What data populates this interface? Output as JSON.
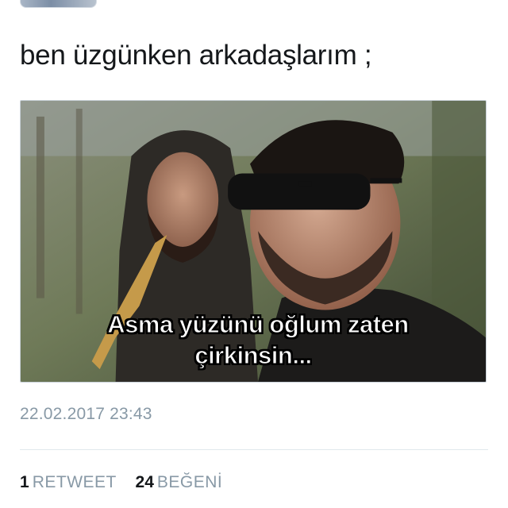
{
  "tweet": {
    "text": "ben üzgünken arkadaşlarım ;",
    "media": {
      "caption_line1": "Asma yüzünü oğlum zaten",
      "caption_line2": "çirkinsin..."
    },
    "timestamp": "22.02.2017 23:43"
  },
  "stats": {
    "retweets_count": "1",
    "retweets_label": "RETWEET",
    "likes_count": "24",
    "likes_label": "BEĞENİ"
  },
  "colors": {
    "text_primary": "#14171a",
    "text_secondary": "#8899a6",
    "divider": "#e1e8ed"
  }
}
